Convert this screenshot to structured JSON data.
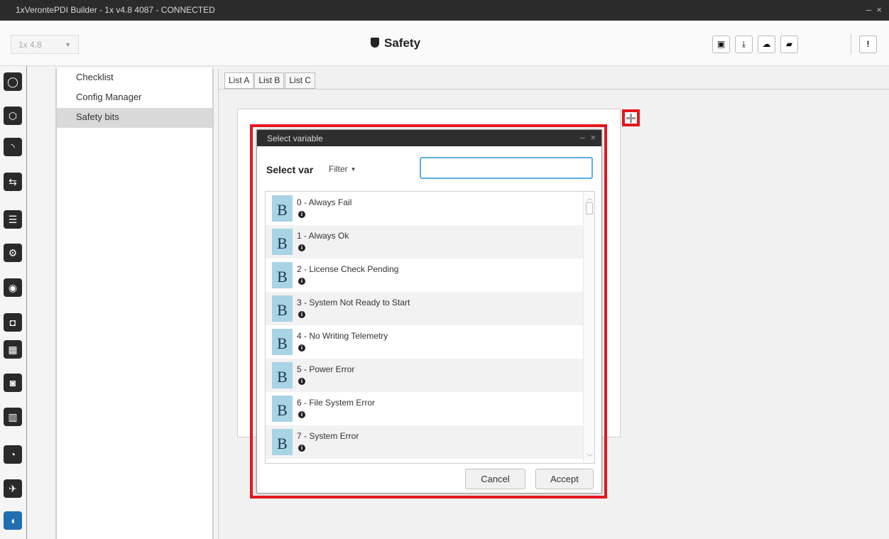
{
  "window": {
    "title": "1xVerontePDI Builder - 1x v4.8 4087 - CONNECTED",
    "controls": "– ×"
  },
  "toolbar": {
    "version": "1x 4.8",
    "page_title": "Safety",
    "buttons": [
      "save-icon",
      "download-icon",
      "cloud-upload-icon",
      "folder-open-icon",
      "alert-icon"
    ]
  },
  "sidebar_icons": [
    "power-icon",
    "hexagon-icon",
    "rss-icon",
    "usb-icon",
    "sliders-icon",
    "cogs-icon",
    "podcast-icon",
    "gamepad-icon",
    "grid-icon",
    "camera-icon",
    "chart-icon",
    "tachometer-icon",
    "plane-icon",
    "shield-icon"
  ],
  "nav": {
    "items": [
      {
        "label": "Checklist"
      },
      {
        "label": "Config Manager"
      },
      {
        "label": "Safety bits"
      }
    ],
    "selected": "Safety bits"
  },
  "tabs": [
    {
      "label": "List A"
    },
    {
      "label": "List B"
    },
    {
      "label": "List C"
    }
  ],
  "dialog": {
    "title": "Select variable",
    "controls": "– ×",
    "select_label": "Select var",
    "filter_label": "Filter",
    "search_value": "",
    "badge_letter": "B",
    "info_glyph": "i",
    "items": [
      {
        "label": "0 - Always Fail"
      },
      {
        "label": "1 - Always Ok"
      },
      {
        "label": "2 - License Check Pending"
      },
      {
        "label": "3 - System Not Ready to Start"
      },
      {
        "label": "4 - No Writing Telemetry"
      },
      {
        "label": "5 - Power Error"
      },
      {
        "label": "6 - File System Error"
      },
      {
        "label": "7 - System Error"
      }
    ],
    "cancel_label": "Cancel",
    "accept_label": "Accept"
  },
  "colors": {
    "highlight": "#e3171e",
    "badge": "#a9d3e6",
    "active_icon": "#1f6fb2"
  }
}
